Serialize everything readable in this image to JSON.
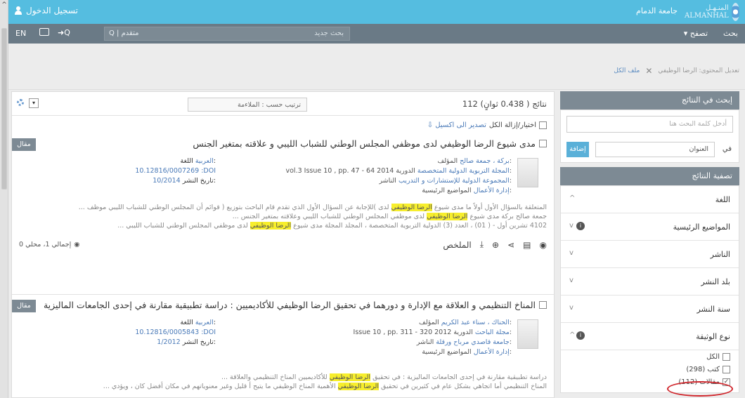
{
  "header": {
    "login_label": "تسجيل الدخول",
    "university": "جامعة الدمام",
    "logo_ar": "المنـهـل",
    "logo_en": "ALMANHAL"
  },
  "navbar": {
    "lang": "EN",
    "search_placeholder": "بحث جديد",
    "advanced_label": "متقدم",
    "search_menu": "بحث",
    "browse_menu": "تصفح"
  },
  "breadcrumb": {
    "filter_label": "تعديل المحتوى: الرضا الوظيفي",
    "link_label": "ملف الكل"
  },
  "results": {
    "count": "112 نتائج ( 0.438 ثوانٍ)",
    "sort_label": "ترتيب حسب : الملاءمة",
    "select_all": "اختيار/إزالة الكل",
    "export_label": "تصدير الى اكسيل",
    "items": [
      {
        "type_tag": "مقال",
        "title": "مدى شيوع الرضا الوظيفي لدى موظفي المجلس الوطني للشباب الليبي و علاقته بمتغير الجنس",
        "author_label": "المؤلف:",
        "author": "بركة ، جمعة صالح",
        "source_label": "الدورية:",
        "source": "المجلة التربوية الدولية المتخصصة",
        "volume": "vol.3 Issue 10 , pp. 47 - 64 2014",
        "publisher_label": "الناشر:",
        "publisher": "المجموعة الدولية للإستشارات و التدريب",
        "topics_label": "المواضيع الرئيسية:",
        "topics": "إدارة الأعمال",
        "lang_label": "اللغة:",
        "lang": "العربية",
        "doi": "10.12816/0007269 :DOI",
        "date_label": "تاريخ النشر:",
        "date": "10/2014",
        "abstract_1": "المتعلقة بالسؤال الأول أولاً ما مدى شيوع",
        "abstract_hl_1": "الرضا الوظيفي",
        "abstract_2": "لدى )للإجابة عن السؤال الأول الذي تقدم قام الباحث بتوزيع ( قوائم أن المجلس الوطني للشباب الليبي موظف ...",
        "abstract_3": "جمعة صالح بركة مدى شيوع",
        "abstract_hl_2": "الرضا الوظيفي",
        "abstract_4": "لدى موظفي المجلس الوطني للشباب الليبي وعلاقته بمتغير الجنس ...",
        "abstract_5": "4102 تشرين أول - ( 01) ، العدد (3) الدولية التربوية المتخصصة ، المجلد المجلة مدى شيوع",
        "abstract_hl_3": "الرضا الوظيفي",
        "abstract_6": "لدى موظفي المجلس الوطني للشباب الليبي ...",
        "summary_label": "الملخص",
        "stats": "إجمالي 1، محلي 0"
      },
      {
        "type_tag": "مقال",
        "title": "المناخ التنظيمي و العلاقة مع الإدارة و دورهما في تحقيق الرضا الوظيفي للأكاديميين : دراسة تطبيقية مقارنة في إحدى الجامعات الماليزية",
        "author_label": "المؤلف:",
        "author": "الحناك ، سناء عبد الكريم",
        "source_label": "الدورية:",
        "source": "مجلة الباحث",
        "volume": "Issue 10 , pp. 311 - 320 2012",
        "publisher_label": "الناشر:",
        "publisher": "جامعة قاصدي مرباح ورقلة",
        "topics_label": "المواضيع الرئيسية:",
        "topics": "إدارة الأعمال",
        "lang_label": "اللغة:",
        "lang": "العربية",
        "doi": "10.12816/0005843 :DOI",
        "date_label": "تاريخ النشر:",
        "date": "1/2012",
        "abstract_1": "دراسة تطبيقية مقارنة في إحدى الجامعات الماليزية : في تحقيق",
        "abstract_hl_1": "الرضا الوظيفي",
        "abstract_2": "للأكاديميين المناخ التنظيمي والعلاقة ...",
        "abstract_3": "المناخ التنظيمي أما اتجاهي بشكل عام في كثيرين في تحقيق",
        "abstract_hl_2": "الرضا الوظيفي",
        "abstract_4": "الأهمية المناخ الوظيفي ما يتيح أ قليل وغير معنوياتهم في مكان أفضل كان ، ويؤدي ..."
      }
    ]
  },
  "sidebar": {
    "search_within_title": "إبحث في النتائج",
    "search_within_placeholder": "أدخل كلمة البحث هنا",
    "in_label": "في",
    "field_value": "العنوان",
    "add_label": "إضافة",
    "filter_title": "تصفية النتائج",
    "facets": [
      {
        "name": "اللغة",
        "chev": "^"
      },
      {
        "name": "المواضيع الرئيسية",
        "chev": "v"
      },
      {
        "name": "الناشر",
        "chev": "v"
      },
      {
        "name": "بلد النشر",
        "chev": "v"
      },
      {
        "name": "سنة النشر",
        "chev": "v"
      },
      {
        "name": "نوع الوثيقة",
        "chev": "^"
      }
    ],
    "doc_type_options": [
      {
        "label": "الكل",
        "checked": false
      },
      {
        "label": "كتب (298)",
        "checked": false
      },
      {
        "label": "مقالات (112)",
        "checked": true
      }
    ]
  }
}
